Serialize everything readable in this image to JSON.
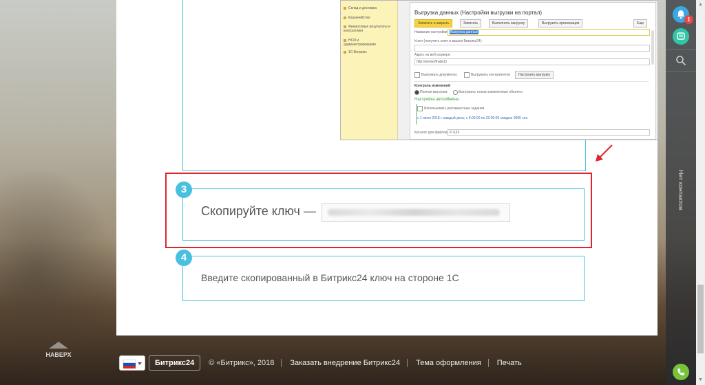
{
  "steps": {
    "step3": {
      "number": "3",
      "text": "Скопируйте ключ —"
    },
    "step4": {
      "number": "4",
      "text": "Введите скопированный в Битрикс24 ключ на стороне 1С"
    }
  },
  "screenshot": {
    "title": "Выгрузка данных (Настройки выгрузки на портал)",
    "buttons": [
      "Записать и закрыть",
      "Записать",
      "Выполнить выгрузку",
      "Выгрузить организации",
      "Еще"
    ],
    "sidebar_items": [
      "Склад и доставка",
      "Казначейство",
      "Финансовые результаты и контроллинг",
      "НСИ и администрирование",
      "1С-Битрикс"
    ],
    "fields": [
      {
        "label": "Название настройки:",
        "value": "Выгрузка данных"
      },
      {
        "label": "Ключ (получить ключ в вашем Битрикс24):",
        "value": ""
      },
      {
        "label": "Адрес на веб-сервере:",
        "value": "http://server/trade11"
      }
    ],
    "checks": [
      "Выгружать документы",
      "Выгружать контрагентов",
      "Настроить выгрузку"
    ],
    "section_changes": "Контроль изменений",
    "radios": [
      "Полная выгрузка",
      "Выгружать только измененные объекты"
    ],
    "autoexchange_title": "Настройка автообмена",
    "autoexchange_check": "Использовать регламентные задания",
    "schedule_link": "с 1 июня 2018 г. каждый день; с 8:00:00 по 22:00:00 каждые 3600 сек.",
    "files_label": "Каталог для файлов:",
    "files_value": "F:\\123"
  },
  "rail": {
    "notifications_count": "1",
    "vertical_label": "Нет контактов"
  },
  "totop_label": "НАВЕРХ",
  "footer": {
    "brand": "Битрикс24",
    "copyright": "© «Битрикс», 2018",
    "order_link": "Заказать внедрение Битрикс24",
    "theme_link": "Тема оформления",
    "print_link": "Печать"
  },
  "colors": {
    "accent": "#4ac0e0",
    "highlight": "#e2232c"
  },
  "icons": [
    "bell-icon",
    "chat-icon",
    "search-icon",
    "phone-icon",
    "arrow-up-icon",
    "russia-flag-icon"
  ]
}
